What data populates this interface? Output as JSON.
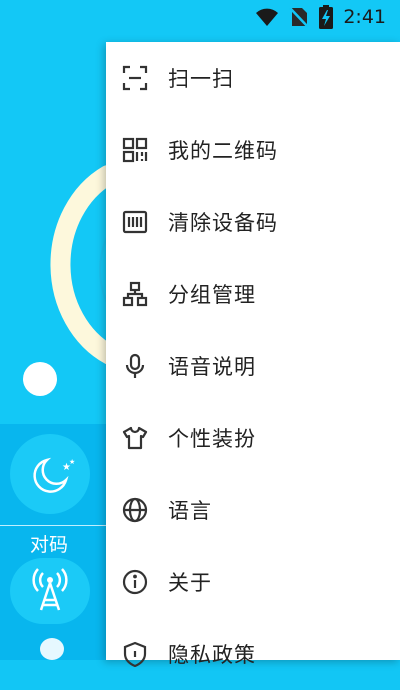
{
  "status_bar": {
    "time": "2:41",
    "icons": [
      "wifi-icon",
      "no-sim-icon",
      "battery-charging-icon"
    ]
  },
  "background": {
    "pair_label": "对码",
    "buttons": [
      "moon-mode-icon",
      "signal-tower-icon",
      "pin-icon"
    ]
  },
  "menu": {
    "items": [
      {
        "label": "扫一扫",
        "icon": "scan-icon"
      },
      {
        "label": "我的二维码",
        "icon": "qr-code-icon"
      },
      {
        "label": "清除设备码",
        "icon": "clear-code-icon"
      },
      {
        "label": "分组管理",
        "icon": "group-icon"
      },
      {
        "label": "语音说明",
        "icon": "microphone-icon"
      },
      {
        "label": "个性装扮",
        "icon": "shirt-icon"
      },
      {
        "label": "语言",
        "icon": "globe-icon"
      },
      {
        "label": "关于",
        "icon": "info-icon"
      },
      {
        "label": "隐私政策",
        "icon": "shield-icon"
      }
    ]
  },
  "colors": {
    "background": "#13C8F6",
    "menu_bg": "#FFFFFF",
    "text": "#222222",
    "dial_arc": "#FDF8DC"
  }
}
